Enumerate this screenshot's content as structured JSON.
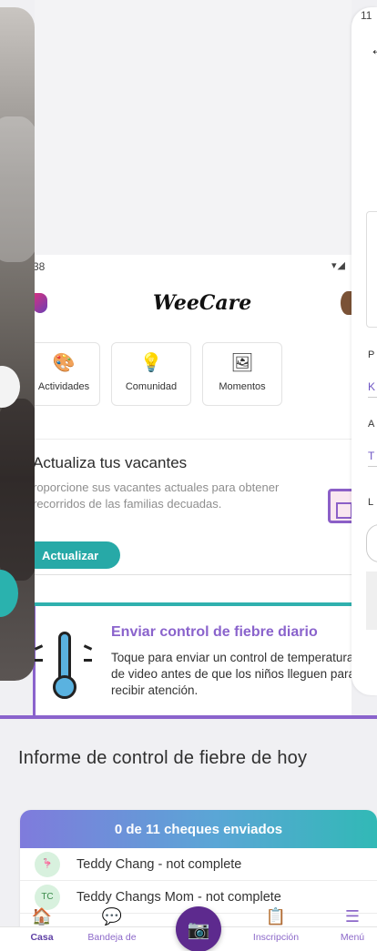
{
  "photo_card": {
    "label": ""
  },
  "weecare_card": {
    "status_time": "38",
    "logo": "WeeCare",
    "tiles": [
      {
        "label": "Actividades",
        "icon": "palette-icon"
      },
      {
        "label": "Comunidad",
        "icon": "lightbulb-icon"
      },
      {
        "label": "Momentos",
        "icon": "photo-icon"
      }
    ],
    "vacancies": {
      "title": "Actualiza tus vacantes",
      "text": "roporcione sus vacantes actuales para obtener recorridos de las familias decuadas.",
      "button": "Actualizar"
    },
    "fever": {
      "title": "Enviar control de fiebre diario",
      "text": "Toque para enviar un control de temperatura de video antes de que los niños lleguen para recibir atención."
    }
  },
  "right_card": {
    "status_time": "11",
    "letters": [
      "P",
      "K",
      "A",
      "T",
      "L"
    ]
  },
  "report": {
    "title": "Informe de control de fiebre de hoy",
    "summary": "0 de 11 cheques enviados",
    "rows": [
      {
        "name": "Teddy Chang - not complete",
        "avatar": ""
      },
      {
        "name": "Teddy Changs Mom - not complete",
        "avatar": "TC"
      }
    ]
  },
  "bottom_nav": {
    "home": "Casa",
    "inbox": "Bandeja de",
    "enroll": "Inscripción",
    "menu": "Menú"
  },
  "colors": {
    "brand_purple": "#5d2a8e",
    "teal": "#27a9a7",
    "lavender": "#8a63cc"
  }
}
